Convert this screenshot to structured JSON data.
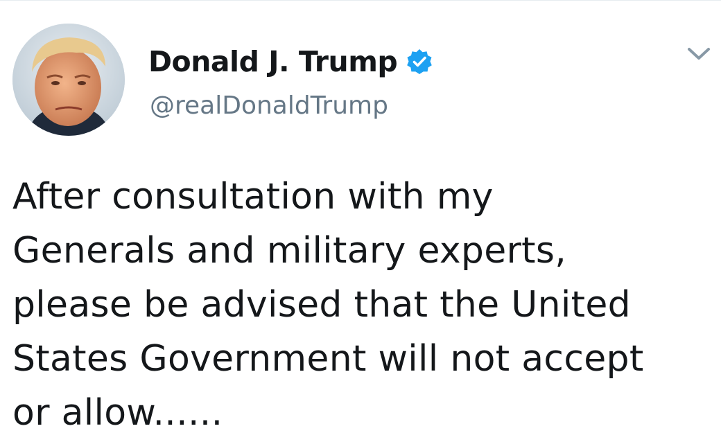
{
  "author": {
    "display_name": "Donald J. Trump",
    "handle": "@realDonaldTrump",
    "verified": true,
    "avatar": "profile-photo"
  },
  "tweet": {
    "text": "After consultation with my\nGenerals and military experts,\nplease be advised that the United\nStates Government will not accept\nor allow......"
  },
  "icons": {
    "verified": "verified-badge-icon",
    "menu": "chevron-down-icon"
  },
  "colors": {
    "verified_blue": "#1da1f2",
    "handle_gray": "#657786",
    "text": "#14171a"
  }
}
